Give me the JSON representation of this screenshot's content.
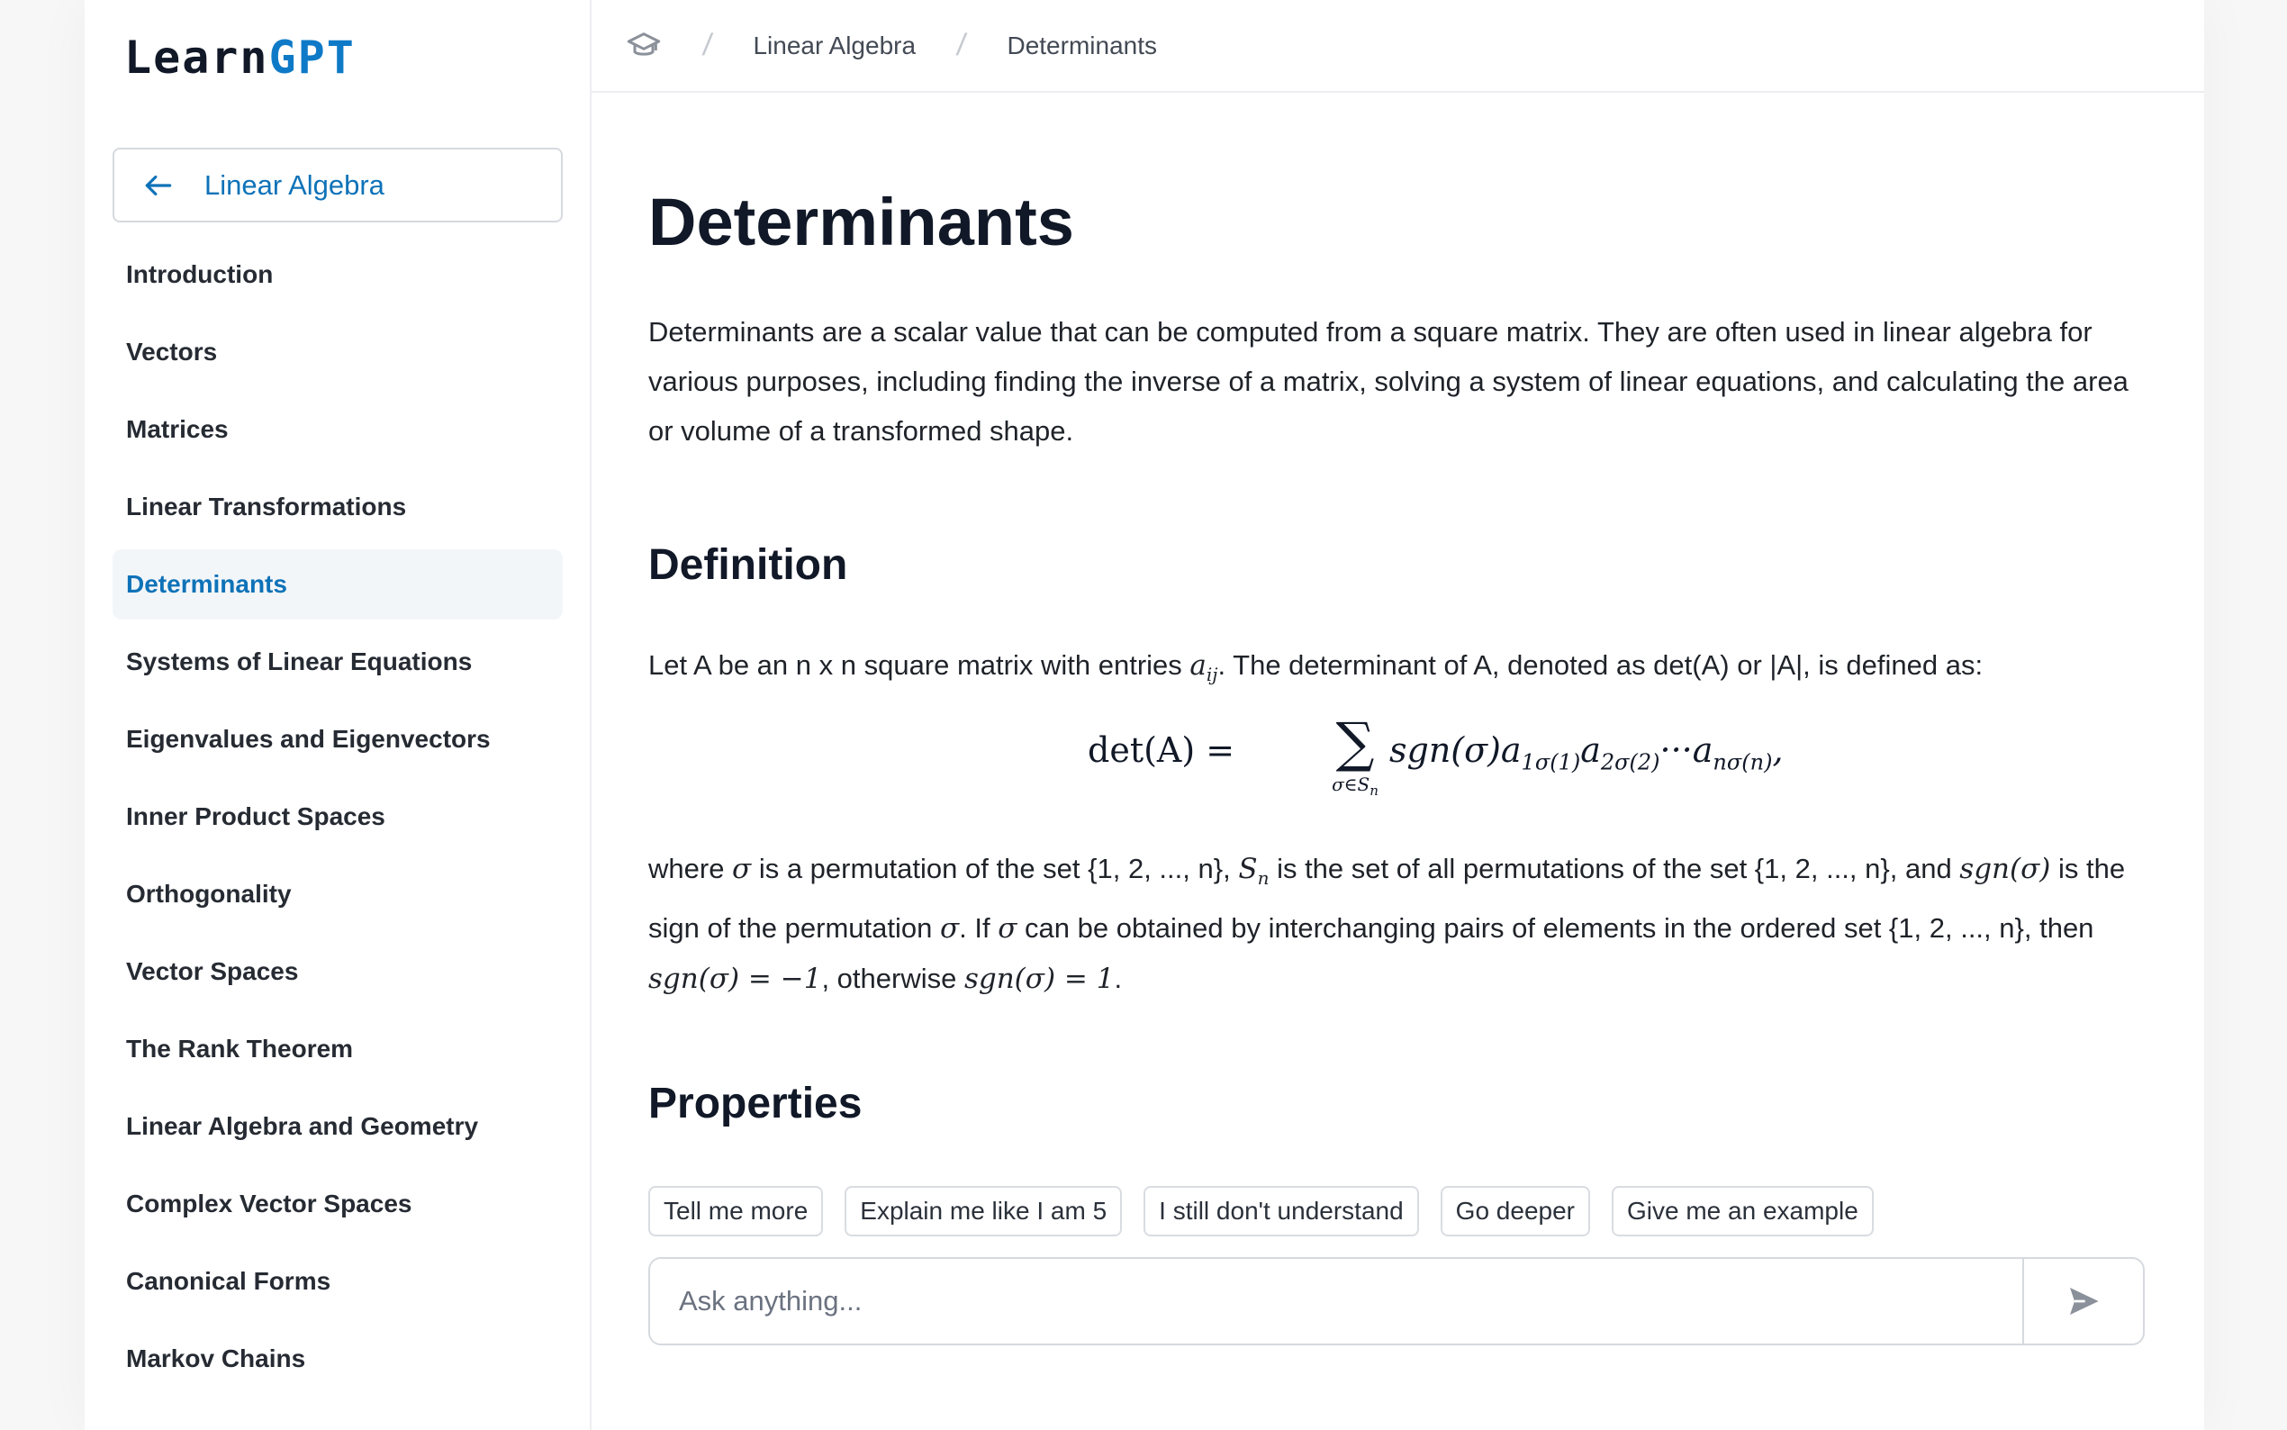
{
  "logo": {
    "part1": "Learn",
    "part2": "GPT"
  },
  "sidebar": {
    "back_label": "Linear Algebra",
    "items": [
      {
        "label": "Introduction"
      },
      {
        "label": "Vectors"
      },
      {
        "label": "Matrices"
      },
      {
        "label": "Linear Transformations"
      },
      {
        "label": "Determinants",
        "active": true
      },
      {
        "label": "Systems of Linear Equations"
      },
      {
        "label": "Eigenvalues and Eigenvectors"
      },
      {
        "label": "Inner Product Spaces"
      },
      {
        "label": "Orthogonality"
      },
      {
        "label": "Vector Spaces"
      },
      {
        "label": "The Rank Theorem"
      },
      {
        "label": "Linear Algebra and Geometry"
      },
      {
        "label": "Complex Vector Spaces"
      },
      {
        "label": "Canonical Forms"
      },
      {
        "label": "Markov Chains"
      }
    ]
  },
  "breadcrumb": {
    "home_icon": "graduation-cap-icon",
    "separator": "/",
    "items": [
      "Linear Algebra",
      "Determinants"
    ]
  },
  "main": {
    "title": "Determinants",
    "intro": "Determinants are a scalar value that can be computed from a square matrix. They are often used in linear algebra for various purposes, including finding the inverse of a matrix, solving a system of linear equations, and calculating the area or volume of a transformed shape.",
    "definition_heading": "Definition",
    "definition_text_1": "Let A be an n x n square matrix with entries ",
    "definition_symbol_aij": "a",
    "definition_symbol_aij_sub": "ij",
    "definition_text_2": ". The determinant of A, denoted as det(A) or |A|, is defined as:",
    "formula": {
      "lhs": "det(A) =",
      "sum_symbol": "∑",
      "sum_sub": "σ∈S",
      "sum_sub_n": "n",
      "sgn": "sgn(σ)",
      "a": "a",
      "sub1": "1σ(1)",
      "sub2": "2σ(2)",
      "dots": "···",
      "subn": "nσ(n)",
      "comma": ","
    },
    "where_parts": {
      "p1": "where ",
      "sigma": "σ",
      "p2": " is a permutation of the set {1, 2, ..., n}, ",
      "Sn": "S",
      "Sn_sub": "n",
      "p3": " is the set of all permutations of the set {1, 2, ..., n}, and ",
      "sgn_sigma": "sgn(σ)",
      "p4": " is the sign of the permutation ",
      "p5": ". If ",
      "p6": " can be obtained by interchanging pairs of elements in the ordered set {1, 2, ..., n}, then ",
      "eq_neg": "sgn(σ) = −1",
      "p7": ", otherwise ",
      "eq_pos": "sgn(σ) = 1",
      "p8": "."
    },
    "properties_heading": "Properties"
  },
  "chips": [
    "Tell me more",
    "Explain me like I am 5",
    "I still don't understand",
    "Go deeper",
    "Give me an example"
  ],
  "ask": {
    "placeholder": "Ask anything...",
    "send_icon": "send-icon"
  },
  "colors": {
    "accent": "#0e72b8",
    "logo_accent": "#0e7ac7",
    "active_bg": "#f3f6f9"
  }
}
